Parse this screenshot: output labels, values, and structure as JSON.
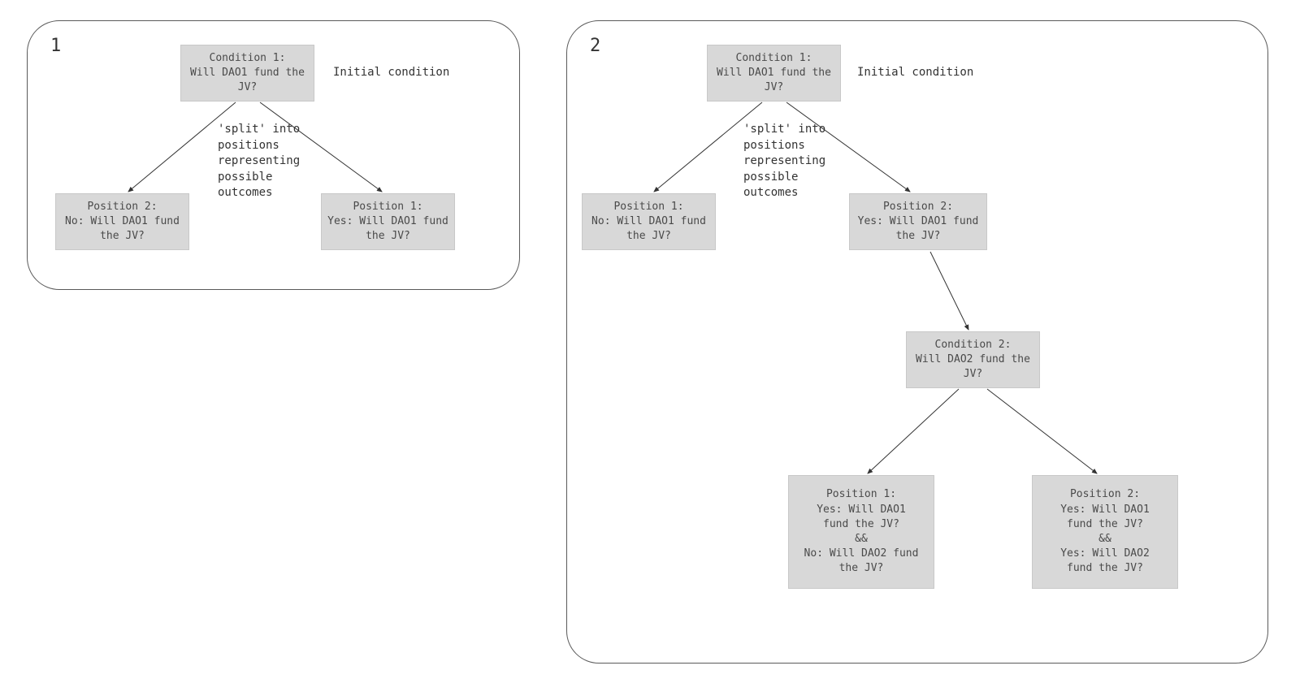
{
  "panels": {
    "one": {
      "label": "1"
    },
    "two": {
      "label": "2"
    }
  },
  "diagram1": {
    "condition1": "Condition 1:\nWill DAO1 fund the\nJV?",
    "initial_ann": "Initial condition",
    "split_ann": "'split' into\npositions\nrepresenting\npossible\noutcomes",
    "position2": "Position 2:\nNo: Will DAO1 fund\nthe JV?",
    "position1": "Position 1:\nYes: Will DAO1 fund\nthe JV?"
  },
  "diagram2": {
    "condition1": "Condition 1:\nWill DAO1 fund the\nJV?",
    "initial_ann": "Initial condition",
    "split_ann": "'split' into\npositions\nrepresenting\npossible\noutcomes",
    "position1": "Position 1:\nNo: Will DAO1 fund\nthe JV?",
    "position2": "Position 2:\nYes: Will DAO1 fund\nthe JV?",
    "condition2": "Condition 2:\nWill DAO2 fund the\nJV?",
    "leaf1": "Position 1:\nYes: Will DAO1\nfund the JV?\n&&\nNo: Will DAO2 fund\nthe JV?",
    "leaf2": "Position 2:\nYes: Will DAO1\nfund the JV?\n&&\nYes: Will DAO2\nfund the JV?"
  }
}
